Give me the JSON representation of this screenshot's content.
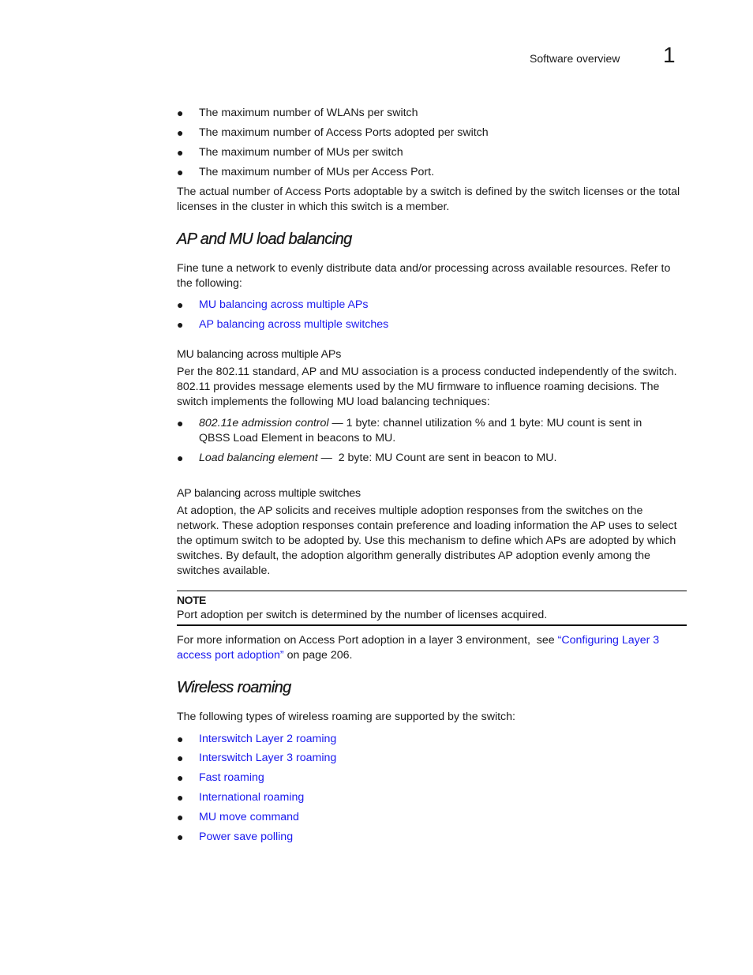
{
  "header": {
    "section_title": "Software overview",
    "chapter_number": "1"
  },
  "intro_bullets": [
    "The maximum number of WLANs per switch",
    "The maximum number of Access Ports adopted per switch",
    "The maximum number of MUs per switch",
    "The maximum number of MUs per Access Port."
  ],
  "intro_paragraph": "The actual number of Access Ports adoptable by a switch is defined by the switch licenses or the total licenses in the cluster in which this switch is a member.",
  "load_balancing": {
    "heading": "AP and MU load balancing",
    "paragraph": "Fine tune a network to evenly distribute data and/or processing across available resources. Refer to the following:",
    "links": [
      "MU balancing across multiple APs",
      "AP balancing across multiple switches"
    ],
    "mu_section": {
      "heading": "MU balancing across multiple APs",
      "paragraph": "Per the 802.11 standard, AP and MU association is a process conducted independently of the switch. 802.11 provides message elements used by the MU firmware to influence roaming decisions. The switch implements the following MU load balancing techniques:",
      "bullets": [
        {
          "term": "802.11e admission control",
          "sep": " — ",
          "text": "1 byte: channel utilization % and 1 byte: MU count is sent in QBSS Load Element in beacons to MU."
        },
        {
          "term": "Load balancing element",
          "sep": " —  ",
          "text": "2 byte: MU Count are sent in beacon to MU."
        }
      ]
    },
    "ap_section": {
      "heading": "AP balancing across multiple switches",
      "paragraph": "At adoption, the AP solicits and receives multiple adoption responses from the switches on the network. These adoption responses contain preference and loading information the AP uses to select the optimum switch to be adopted by. Use this mechanism to define which APs are adopted by which switches. By default, the adoption algorithm generally distributes AP adoption evenly among the switches available."
    },
    "note": {
      "label": "NOTE",
      "text": "Port adoption per switch is determined by the number of licenses acquired."
    },
    "more_info": {
      "prefix": "For more information on Access Port adoption in a layer 3 environment,  see ",
      "link": "“Configuring Layer 3 access port adoption”",
      "suffix": " on page 206."
    }
  },
  "wireless_roaming": {
    "heading": "Wireless roaming",
    "paragraph": "The following types of wireless roaming are supported by the switch:",
    "links": [
      "Interswitch Layer 2 roaming",
      "Interswitch Layer 3 roaming",
      "Fast roaming",
      "International roaming",
      "MU move command",
      "Power save polling"
    ]
  },
  "colors": {
    "link": "#1a1aee",
    "text": "#1a1a1a"
  }
}
